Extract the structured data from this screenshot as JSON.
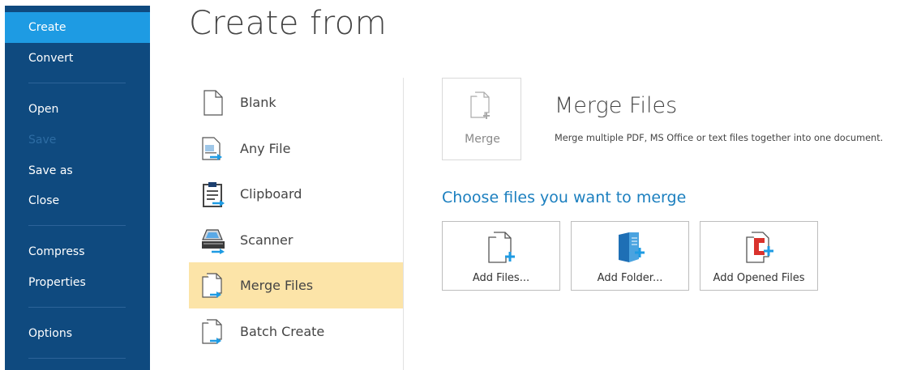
{
  "nav": {
    "items": [
      {
        "label": "Create"
      },
      {
        "label": "Convert"
      },
      {
        "label": "Open"
      },
      {
        "label": "Save"
      },
      {
        "label": "Save as"
      },
      {
        "label": "Close"
      },
      {
        "label": "Compress"
      },
      {
        "label": "Properties"
      },
      {
        "label": "Options"
      }
    ]
  },
  "page_title": "Create from",
  "sources": [
    {
      "label": "Blank",
      "icon": "blank-page-icon"
    },
    {
      "label": "Any File",
      "icon": "any-file-icon"
    },
    {
      "label": "Clipboard",
      "icon": "clipboard-icon"
    },
    {
      "label": "Scanner",
      "icon": "scanner-icon"
    },
    {
      "label": "Merge Files",
      "icon": "merge-files-icon"
    },
    {
      "label": "Batch Create",
      "icon": "batch-create-icon"
    }
  ],
  "detail": {
    "merge_label": "Merge",
    "title": "Merge Files",
    "description": "Merge multiple PDF, MS Office or text files together into one document.",
    "choose_heading": "Choose files you want to merge",
    "actions": [
      {
        "label": "Add Files...",
        "icon": "add-files-icon"
      },
      {
        "label": "Add Folder...",
        "icon": "add-folder-icon"
      },
      {
        "label": "Add Opened Files",
        "icon": "add-opened-files-icon"
      }
    ]
  },
  "colors": {
    "nav_bg": "#0f4a7f",
    "nav_active": "#1e9be3",
    "selected_bg": "#fce4a8",
    "accent_blue": "#1b7fbf",
    "accent_red": "#d9322c"
  }
}
